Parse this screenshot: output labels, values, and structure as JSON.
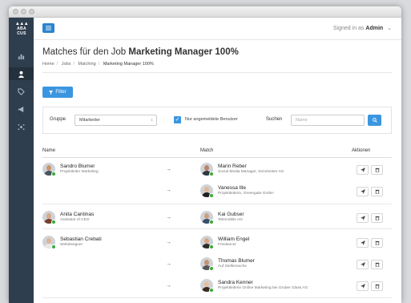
{
  "app": {
    "logo_text": "ABA\nCUS"
  },
  "header": {
    "signed_in_prefix": "Signed in as",
    "user": "Admin"
  },
  "page": {
    "title_prefix": "Matches für den Job",
    "title_job": "Marketing Manager 100%",
    "breadcrumb": [
      "Home",
      "Jobs",
      "Matching",
      "Marketing Manager 100%"
    ]
  },
  "filter": {
    "button_label": "Filter",
    "gruppe_label": "Gruppe",
    "gruppe_value": "Mitarbeiter",
    "checkbox_label": "Nur angemeldete Benutzer",
    "search_label": "Suchen",
    "search_placeholder": "Name"
  },
  "table": {
    "col_name": "Name",
    "col_match": "Match",
    "col_actions": "Aktionen"
  },
  "persons": [
    {
      "name": "Sandro Blumer",
      "sub": "Projektleiter Marketing"
    },
    {
      "name": "Anita Cantinas",
      "sub": "Assistant of CEO"
    },
    {
      "name": "Sebastian Crebati",
      "sub": "Webdesigner"
    }
  ],
  "matches": [
    {
      "name": "Marin Reber",
      "sub": "Social Media Manager, Sennheiser AG"
    },
    {
      "name": "Vanessa Ille",
      "sub": "Projektleiterin, Greengate GmbH"
    },
    {
      "name": "Kai Gubser",
      "sub": "Telemobile AG"
    },
    {
      "name": "William Engel",
      "sub": "Freelancer"
    },
    {
      "name": "Thomas Blumer",
      "sub": "Auf Stellensuche"
    },
    {
      "name": "Sandra Kenner",
      "sub": "Projektleiterin Online Marketing bei Gruber Glass AG"
    }
  ],
  "icons": {
    "send": "send-icon",
    "delete": "trash-icon",
    "arrow": "→"
  },
  "colors": {
    "sidebar": "#2e3e4e",
    "primary": "#3b96df",
    "online_badge": "#3aaa35"
  }
}
